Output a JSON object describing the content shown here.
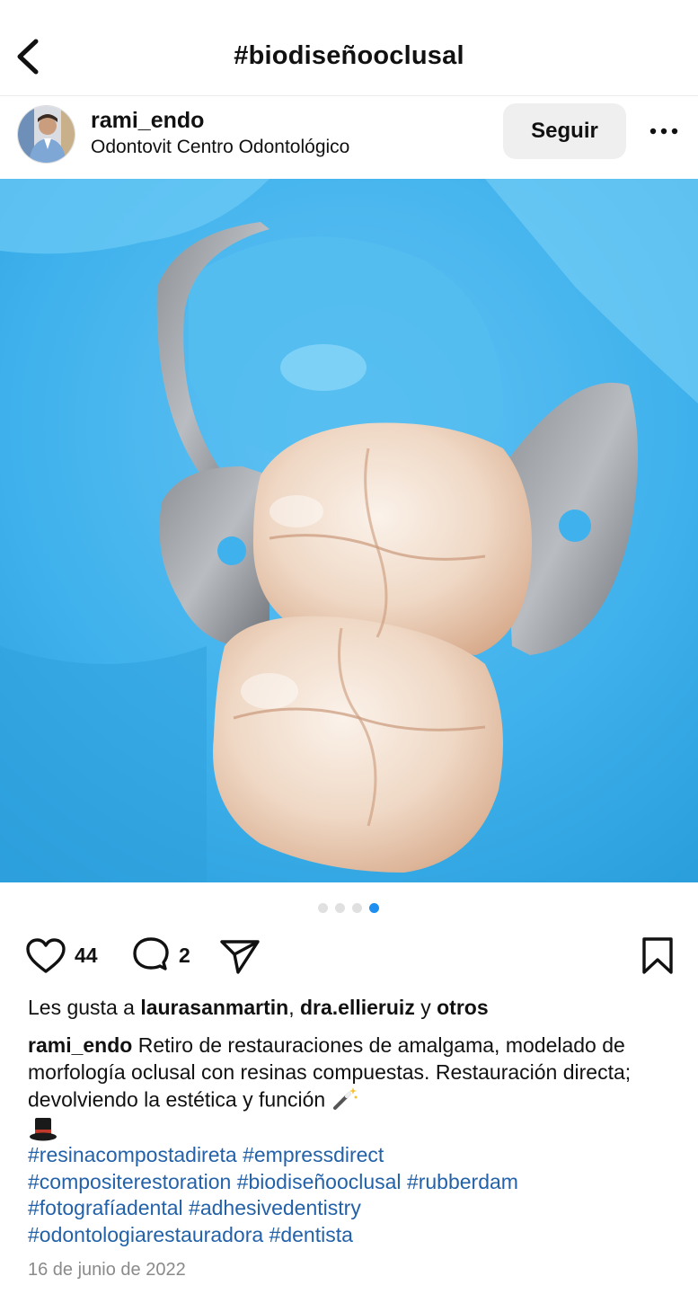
{
  "header": {
    "title": "#biodiseñooclusal"
  },
  "post": {
    "username": "rami_endo",
    "location": "Odontovit Centro Odontológico",
    "follow_label": "Seguir",
    "carousel": {
      "total": 4,
      "active": 4
    },
    "likes_count": "44",
    "comments_count": "2",
    "liked_by": {
      "prefix": "Les gusta a ",
      "user1": "laurasanmartin",
      "sep": ", ",
      "user2": "dra.ellieruiz",
      "and": " y ",
      "others": "otros"
    },
    "caption": {
      "user": "rami_endo",
      "text": " Retiro de restauraciones de amalgama, modelado de morfología oclusal con resinas compuestas. Restauración directa; devolviendo la estética y función "
    },
    "hashtags": [
      "#resinacompostadireta",
      "#empressdirect",
      "#compositerestoration",
      "#biodiseñooclusal",
      "#rubberdam",
      "#fotografíadental",
      "#adhesivedentistry",
      "#odontologiarestauradora",
      "#dentista"
    ],
    "date": "16 de junio de 2022"
  },
  "colors": {
    "hashtag": "#2361a8",
    "dam_blue": "#3fb1ec",
    "active_dot": "#1d8ff0"
  }
}
